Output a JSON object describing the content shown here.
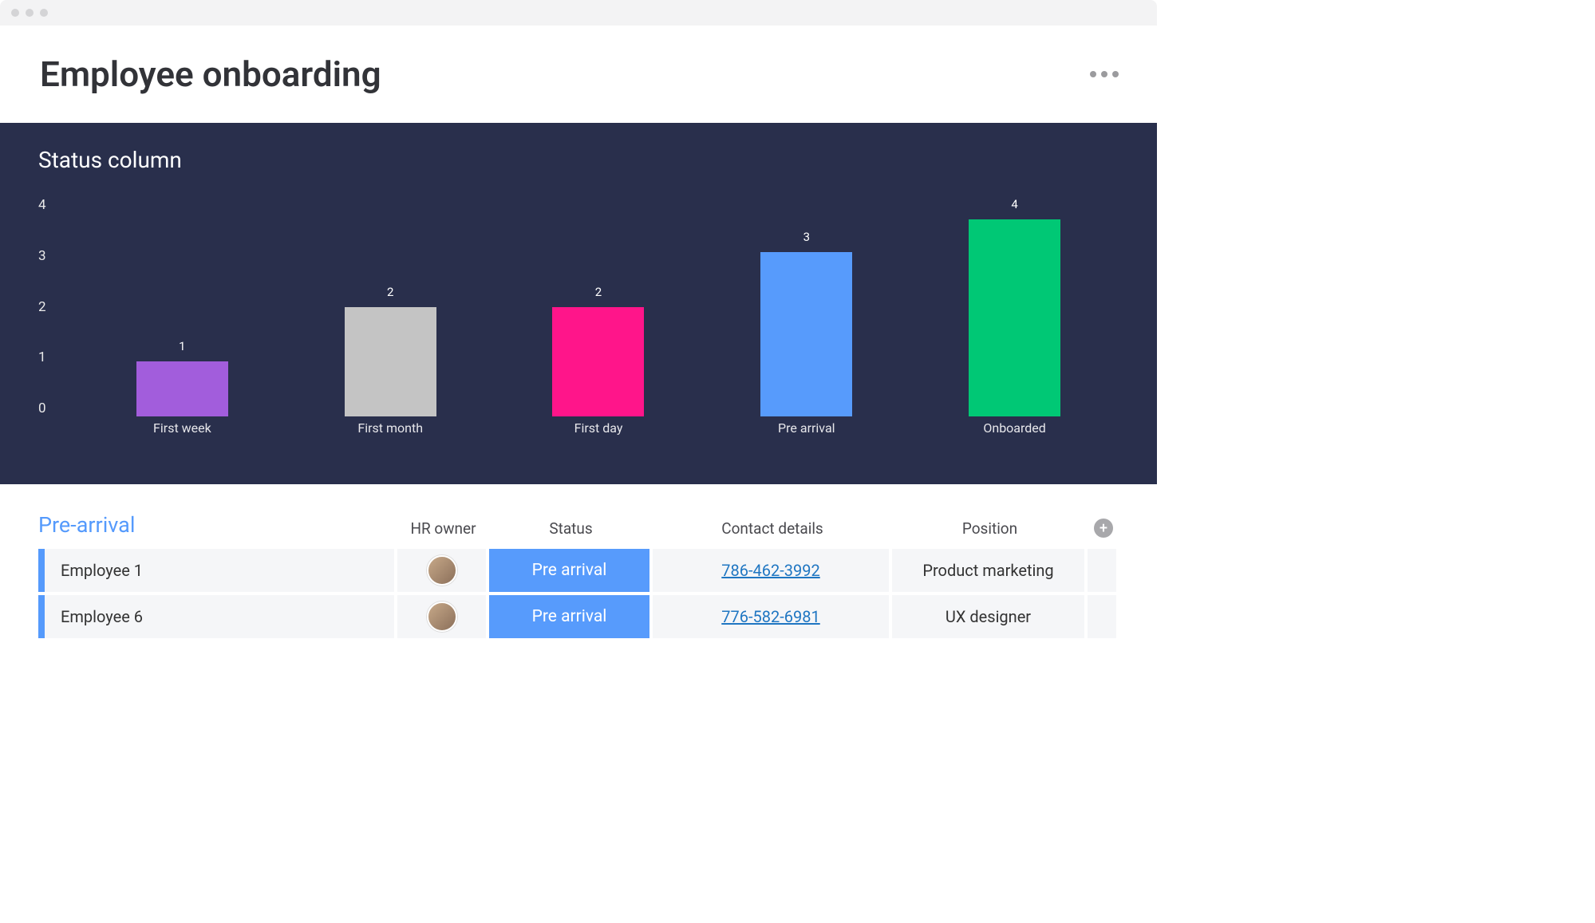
{
  "page_title": "Employee onboarding",
  "chart_panel_title": "Status column",
  "chart_data": {
    "type": "bar",
    "title": "Status column",
    "xlabel": "",
    "ylabel": "",
    "ylim": [
      0,
      4
    ],
    "yticks": [
      4,
      3,
      2,
      1,
      0
    ],
    "categories": [
      "First week",
      "First month",
      "First day",
      "Pre arrival",
      "Onboarded"
    ],
    "values": [
      1,
      2,
      2,
      3,
      4
    ],
    "colors": [
      "#a25ddc",
      "#c4c4c4",
      "#ff158a",
      "#579bfc",
      "#00c875"
    ]
  },
  "table": {
    "group_title": "Pre-arrival",
    "columns": {
      "owner": "HR owner",
      "status": "Status",
      "contact": "Contact details",
      "position": "Position"
    },
    "rows": [
      {
        "name": "Employee 1",
        "status": "Pre arrival",
        "contact": "786-462-3992",
        "position": "Product marketing"
      },
      {
        "name": "Employee 6",
        "status": "Pre arrival",
        "contact": "776-582-6981",
        "position": "UX designer"
      }
    ]
  }
}
